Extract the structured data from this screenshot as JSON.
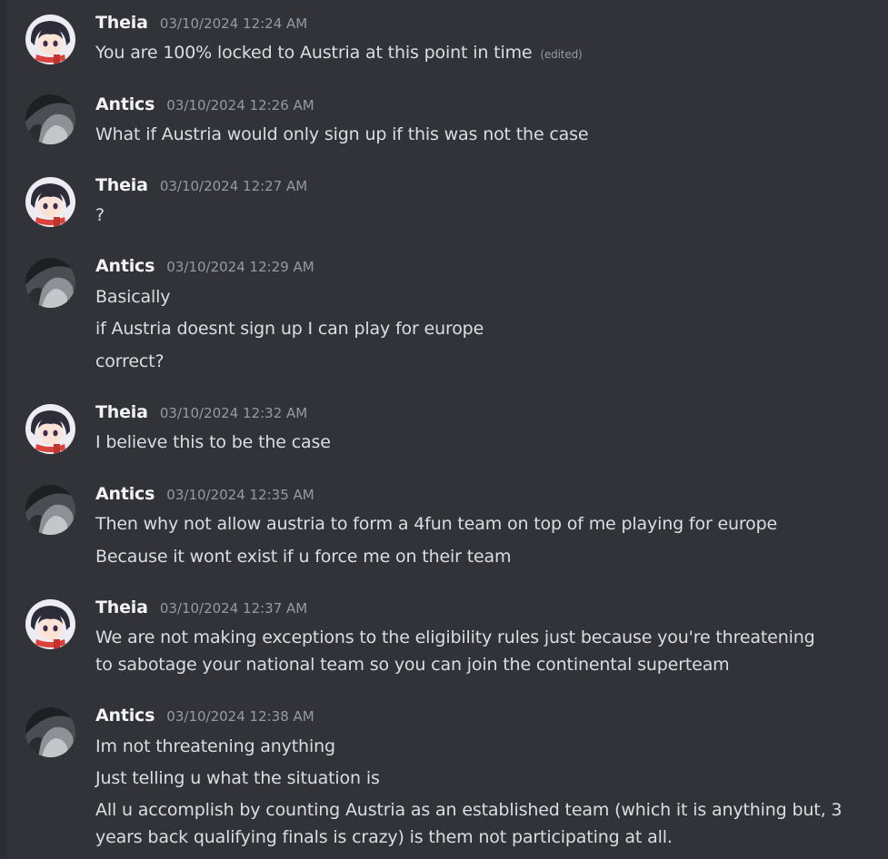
{
  "messages": [
    {
      "author": "Theia",
      "avatar": "theia-avatar",
      "timestamp": "03/10/2024 12:24 AM",
      "lines": [
        "You are 100% locked to Austria at this point in time"
      ],
      "edited_label": "(edited)"
    },
    {
      "author": "Antics",
      "avatar": "antics-avatar",
      "timestamp": "03/10/2024 12:26 AM",
      "lines": [
        "What if Austria would only sign up if this was not the case"
      ]
    },
    {
      "author": "Theia",
      "avatar": "theia-avatar",
      "timestamp": "03/10/2024 12:27 AM",
      "lines": [
        "?"
      ]
    },
    {
      "author": "Antics",
      "avatar": "antics-avatar",
      "timestamp": "03/10/2024 12:29 AM",
      "lines": [
        "Basically",
        "if Austria doesnt sign up I can play for europe",
        "correct?"
      ]
    },
    {
      "author": "Theia",
      "avatar": "theia-avatar",
      "timestamp": "03/10/2024 12:32 AM",
      "lines": [
        "I believe this to be the case"
      ]
    },
    {
      "author": "Antics",
      "avatar": "antics-avatar",
      "timestamp": "03/10/2024 12:35 AM",
      "lines": [
        "Then why not allow austria to form a 4fun team on top of me playing for europe",
        "Because it wont exist if u force me on their team"
      ]
    },
    {
      "author": "Theia",
      "avatar": "theia-avatar",
      "timestamp": "03/10/2024 12:37 AM",
      "lines": [
        "We are not making exceptions to the eligibility rules just because you're threatening to sabotage your national team so you can join the continental superteam"
      ]
    },
    {
      "author": "Antics",
      "avatar": "antics-avatar",
      "timestamp": "03/10/2024 12:38 AM",
      "lines": [
        "Im not threatening anything",
        "Just telling u what the situation is",
        "All u accomplish by counting Austria as an established team (which it is anything but, 3 years back qualifying finals is crazy) is them not participating at all."
      ]
    }
  ]
}
